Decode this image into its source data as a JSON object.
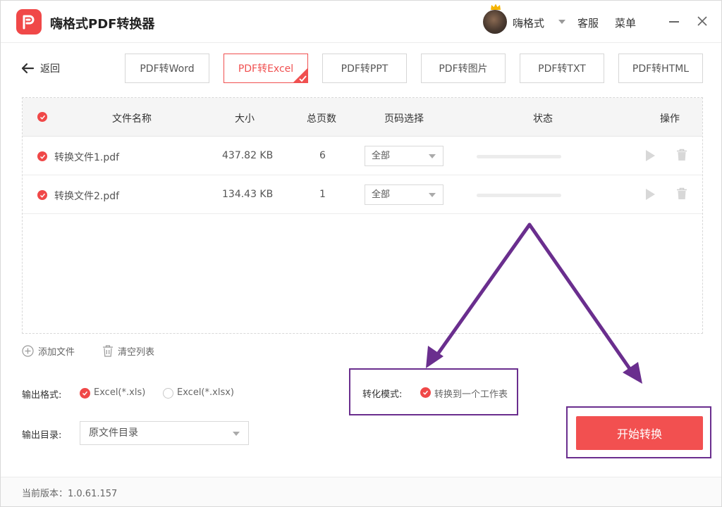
{
  "app": {
    "title": "嗨格式PDF转换器"
  },
  "header": {
    "user_name": "嗨格式",
    "service": "客服",
    "menu": "菜单"
  },
  "nav": {
    "back": "返回",
    "tabs": [
      {
        "label": "PDF转Word",
        "active": false
      },
      {
        "label": "PDF转Excel",
        "active": true
      },
      {
        "label": "PDF转PPT",
        "active": false
      },
      {
        "label": "PDF转图片",
        "active": false
      },
      {
        "label": "PDF转TXT",
        "active": false
      },
      {
        "label": "PDF转HTML",
        "active": false
      }
    ]
  },
  "table": {
    "columns": {
      "name": "文件名称",
      "size": "大小",
      "pages": "总页数",
      "page_select": "页码选择",
      "status": "状态",
      "action": "操作"
    },
    "rows": [
      {
        "name": "转换文件1.pdf",
        "size": "437.82 KB",
        "pages": "6",
        "page_select": "全部",
        "progress": 0
      },
      {
        "name": "转换文件2.pdf",
        "size": "134.43 KB",
        "pages": "1",
        "page_select": "全部",
        "progress": 0
      }
    ]
  },
  "toolbar": {
    "add_file": "添加文件",
    "clear_list": "清空列表"
  },
  "output": {
    "format_label": "输出格式:",
    "format_options": [
      {
        "label": "Excel(*.xls)",
        "selected": true
      },
      {
        "label": "Excel(*.xlsx)",
        "selected": false
      }
    ],
    "dir_label": "输出目录:",
    "dir_value": "原文件目录"
  },
  "mode": {
    "label": "转化模式:",
    "option": "转换到一个工作表",
    "selected": true
  },
  "start_button": "开始转换",
  "footer": {
    "version": "当前版本：1.0.61.157"
  },
  "colors": {
    "accent": "#f04848",
    "annotation": "#6a2e8e"
  }
}
